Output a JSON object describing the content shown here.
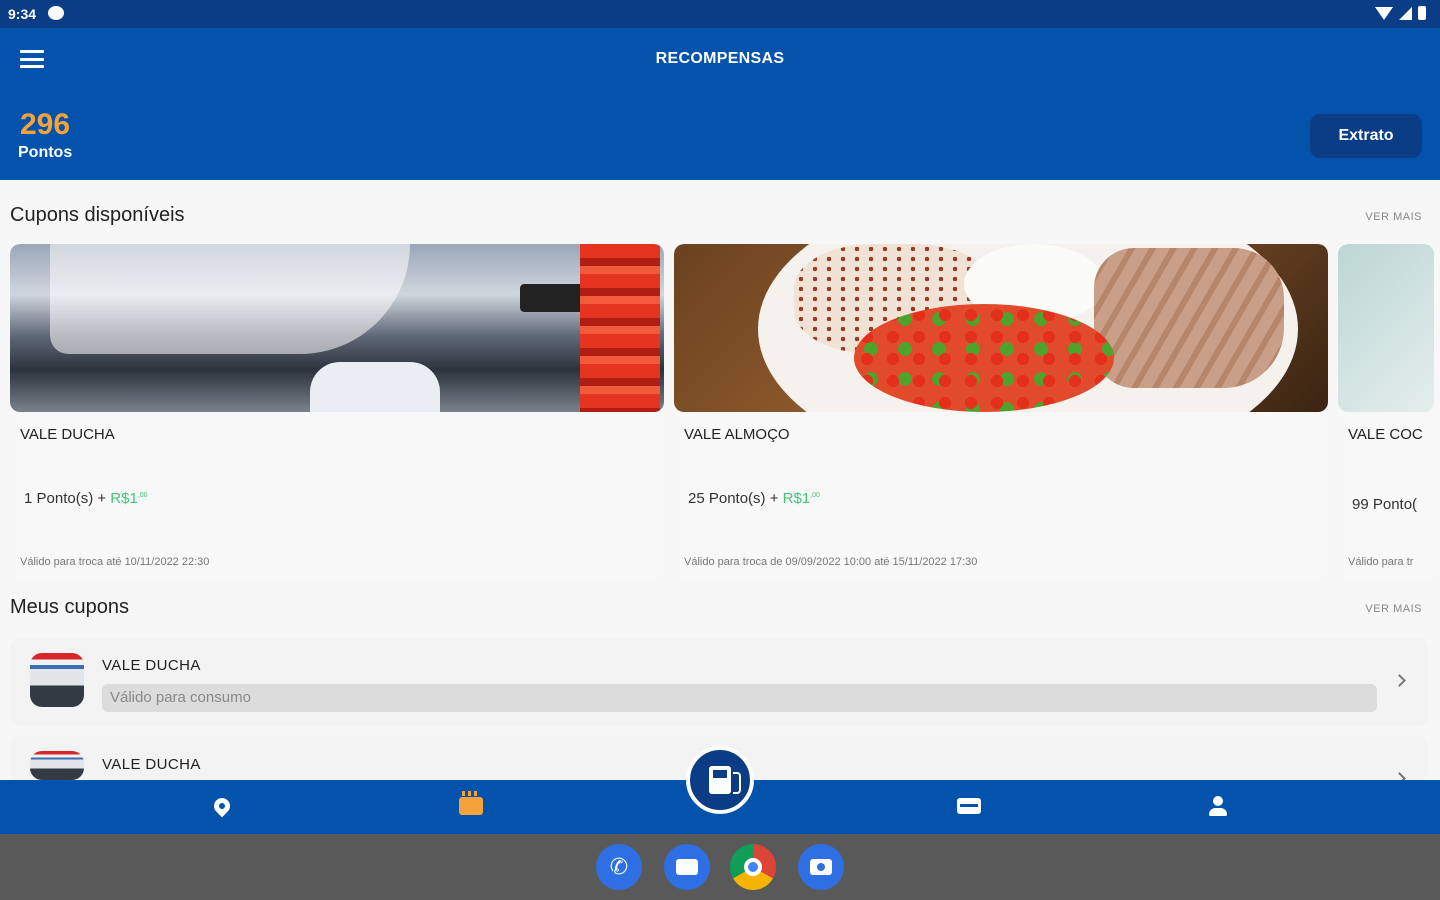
{
  "status_bar": {
    "time": "9:34"
  },
  "app_bar": {
    "title": "RECOMPENSAS",
    "points_value": "296",
    "points_label": "Pontos",
    "statement_button": "Extrato"
  },
  "available_coupons": {
    "title": "Cupons disponíveis",
    "see_more": "VER MAIS",
    "items": [
      {
        "title": "VALE DUCHA",
        "points": "1 Ponto(s) + ",
        "money": "R$1",
        "money_cents": ",00",
        "validity": "Válido para troca até 10/11/2022 22:30",
        "image": "car-wash-photo"
      },
      {
        "title": "VALE ALMOÇO",
        "points": "25 Ponto(s) + ",
        "money": "R$1",
        "money_cents": ",00",
        "validity": "Válido para troca de 09/09/2022 10:00 até 15/11/2022 17:30",
        "image": "lunch-plate-photo"
      },
      {
        "title": "VALE COC",
        "points": "99 Ponto(",
        "money": "",
        "money_cents": "",
        "validity": "Válido para tr",
        "image": "coconut-photo"
      }
    ]
  },
  "my_coupons": {
    "title": "Meus cupons",
    "see_more": "VER MAIS",
    "items": [
      {
        "title": "VALE DUCHA",
        "status": "Válido para consumo"
      },
      {
        "title": "VALE DUCHA",
        "status": ""
      }
    ]
  },
  "bottom_nav": {
    "items": [
      {
        "icon": "location-pin-icon"
      },
      {
        "icon": "gift-icon",
        "active_color": "#f5a23a"
      },
      {
        "icon": "fuel-pump-icon"
      },
      {
        "icon": "ticket-icon"
      },
      {
        "icon": "profile-icon"
      }
    ]
  },
  "dock": {
    "apps": [
      "phone-icon",
      "messages-icon",
      "chrome-icon",
      "camera-icon"
    ]
  },
  "colors": {
    "primary": "#0352ab",
    "primary_dark": "#0b3d86",
    "accent_orange": "#f5a23a",
    "price_green": "#46c27a"
  }
}
